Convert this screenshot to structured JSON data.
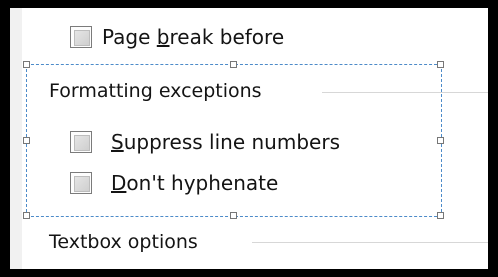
{
  "options": {
    "page_break": {
      "pre": "Page ",
      "mnemonic": "b",
      "post": "reak before"
    }
  },
  "formatting_exceptions": {
    "title": "Formatting exceptions",
    "suppress_line_numbers": {
      "pre": "",
      "mnemonic": "S",
      "post": "uppress line numbers"
    },
    "dont_hyphenate": {
      "pre": "",
      "mnemonic": "D",
      "post": "on't hyphenate"
    }
  },
  "textbox_options": {
    "title": "Textbox options"
  }
}
